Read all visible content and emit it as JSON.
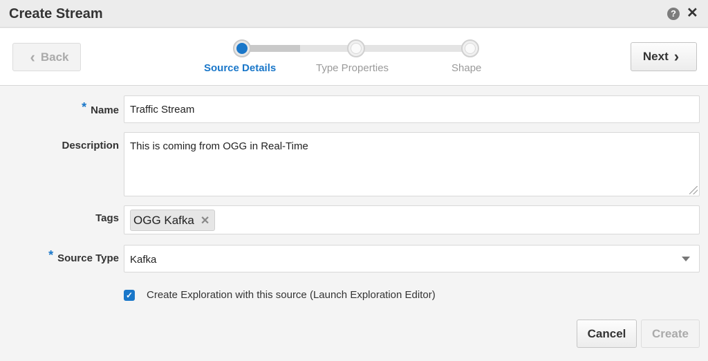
{
  "dialog": {
    "title": "Create Stream"
  },
  "train": {
    "back_label": "Back",
    "next_label": "Next",
    "steps": [
      {
        "label": "Source Details",
        "active": true
      },
      {
        "label": "Type Properties",
        "active": false
      },
      {
        "label": "Shape",
        "active": false
      }
    ]
  },
  "form": {
    "name": {
      "label": "Name",
      "value": "Traffic Stream",
      "required": true
    },
    "description": {
      "label": "Description",
      "value": "This is coming from OGG in Real-Time"
    },
    "tags": {
      "label": "Tags",
      "items": [
        "OGG Kafka"
      ]
    },
    "source_type": {
      "label": "Source Type",
      "value": "Kafka",
      "required": true
    },
    "exploration": {
      "label": "Create Exploration with this source (Launch Exploration Editor)",
      "checked": true
    }
  },
  "footer": {
    "cancel_label": "Cancel",
    "create_label": "Create"
  },
  "colors": {
    "accent": "#1a77c9"
  }
}
